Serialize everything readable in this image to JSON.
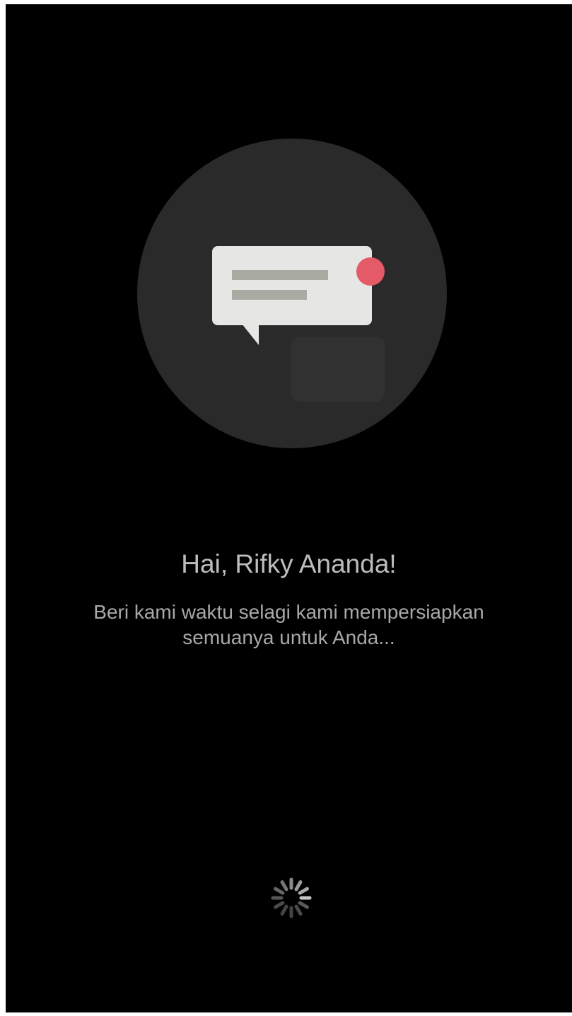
{
  "app": {
    "background": "#000000",
    "accent": "#e45a66"
  },
  "illustration": {
    "icon": "chat-bubble-notification-icon",
    "circle_color": "#2a2a2a",
    "bubble_color": "#e6e6e4",
    "line_color": "#a9aaa2",
    "badge_color": "#e45a66"
  },
  "greeting": {
    "title": "Hai, Rifky Ananda!",
    "message": "Beri kami waktu selagi kami mempersiapkan semuanya untuk Anda..."
  },
  "loading": {
    "icon": "loading-spinner-icon"
  }
}
